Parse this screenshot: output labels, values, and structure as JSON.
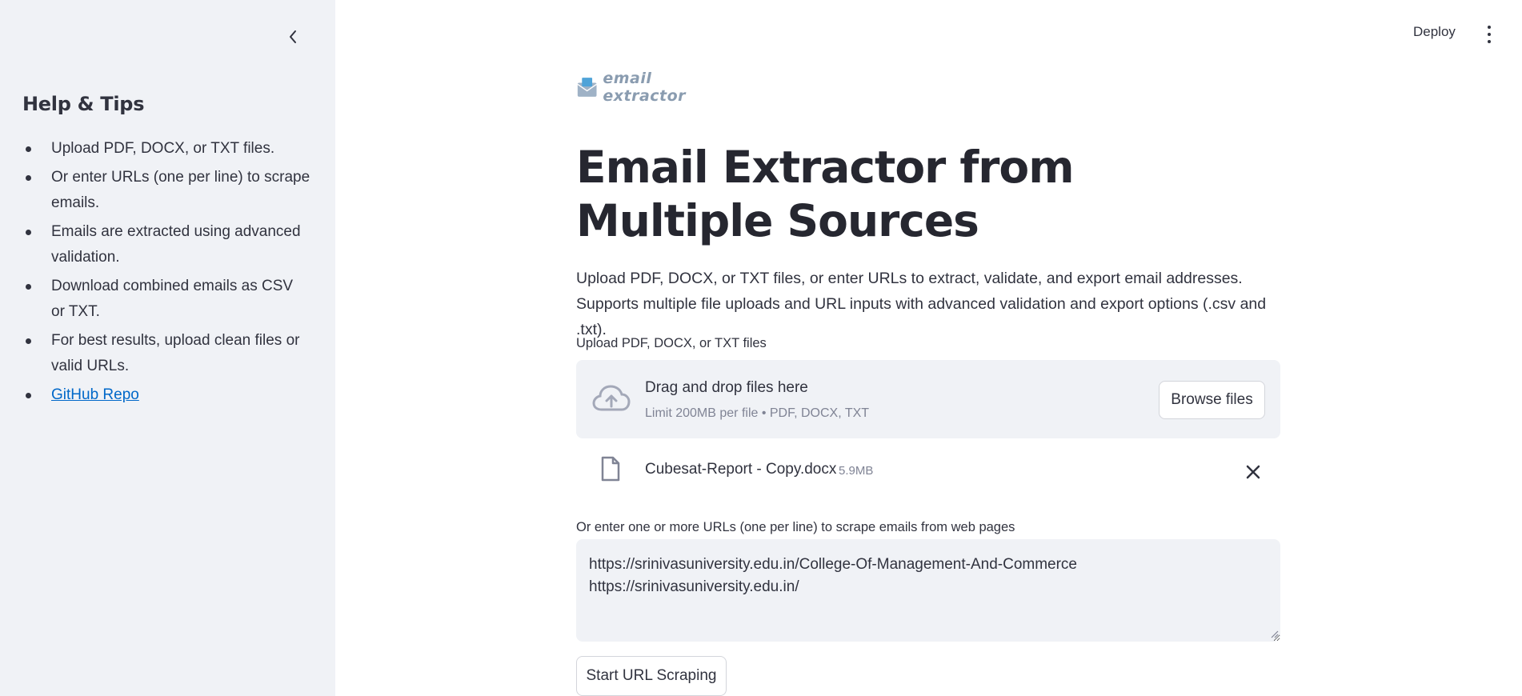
{
  "sidebar": {
    "heading": "Help & Tips",
    "tips": [
      "Upload PDF, DOCX, or TXT files.",
      "Or enter URLs (one per line) to scrape emails.",
      "Emails are extracted using advanced validation.",
      "Download combined emails as CSV or TXT.",
      "For best results, upload clean files or valid URLs."
    ],
    "link_label": "GitHub Repo"
  },
  "header": {
    "deploy_label": "Deploy"
  },
  "main": {
    "logo_text": "email extractor",
    "title": "Email Extractor from Multiple Sources",
    "description": "Upload PDF, DOCX, or TXT files, or enter URLs to extract, validate, and export email addresses. Supports multiple file uploads and URL inputs with advanced validation and export options (.csv and .txt).",
    "upload_label": "Upload PDF, DOCX, or TXT files",
    "dropzone_title": "Drag and drop files here",
    "dropzone_limit": "Limit 200MB per file • PDF, DOCX, TXT",
    "browse_label": "Browse files",
    "uploaded_file": {
      "name": "Cubesat-Report - Copy.docx",
      "size": "5.9MB"
    },
    "url_label": "Or enter one or more URLs (one per line) to scrape emails from web pages",
    "url_value": "https://srinivasuniversity.edu.in/College-Of-Management-And-Commerce\nhttps://srinivasuniversity.edu.in/",
    "scrape_label": "Start URL Scraping"
  },
  "colors": {
    "sidebar_bg": "#f0f2f6",
    "text": "#31333f",
    "link": "#0068c9",
    "muted": "#808495"
  }
}
